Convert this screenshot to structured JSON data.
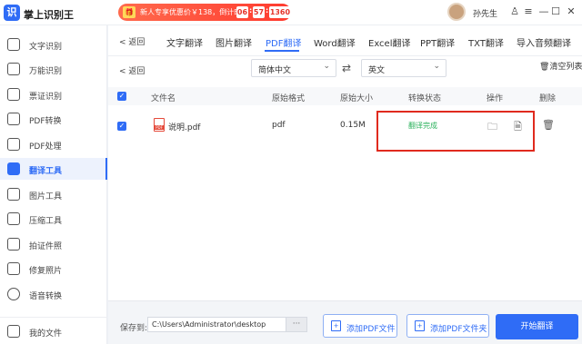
{
  "app": {
    "title": "掌上识别王",
    "logo_glyph": "识"
  },
  "promo": {
    "text": "新人专享优惠价￥138，倒计时",
    "countdown": [
      "06",
      "57",
      "13",
      "60"
    ],
    "separator": ":"
  },
  "user": {
    "name": "孙先生"
  },
  "window": {
    "skin": "♙",
    "menu": "≡",
    "minimize": "—",
    "maximize": "☐",
    "close": "✕"
  },
  "sidebar": {
    "items": [
      {
        "label": "文字识别",
        "icon": "text-recognition-icon"
      },
      {
        "label": "万能识别",
        "icon": "universal-recognition-icon"
      },
      {
        "label": "票证识别",
        "icon": "ticket-recognition-icon"
      },
      {
        "label": "PDF转换",
        "icon": "pdf-convert-icon"
      },
      {
        "label": "PDF处理",
        "icon": "pdf-process-icon"
      },
      {
        "label": "翻译工具",
        "icon": "translate-tool-icon",
        "active": true
      },
      {
        "label": "图片工具",
        "icon": "image-tool-icon"
      },
      {
        "label": "压缩工具",
        "icon": "compress-tool-icon"
      },
      {
        "label": "拍证件照",
        "icon": "id-photo-icon"
      },
      {
        "label": "修复照片",
        "icon": "photo-repair-icon"
      },
      {
        "label": "语音转换",
        "icon": "voice-convert-icon"
      }
    ],
    "my_files": "我的文件"
  },
  "nav": {
    "back": "返回",
    "tabs": [
      "文字翻译",
      "图片翻译",
      "PDF翻译",
      "Word翻译",
      "Excel翻译",
      "PPT翻译",
      "TXT翻译",
      "导入音频翻译"
    ],
    "active_tab": "PDF翻译"
  },
  "lang": {
    "back": "返回",
    "source": "简体中文",
    "target": "英文",
    "swap": "⇄",
    "clear_list": "清空列表"
  },
  "table": {
    "headers": [
      "文件名",
      "原始格式",
      "原始大小",
      "转换状态",
      "操作",
      "删除"
    ],
    "rows": [
      {
        "name": "说明.pdf",
        "format": "pdf",
        "size": "0.15M",
        "status": "翻译完成"
      }
    ]
  },
  "bottom": {
    "save_label": "保存到:",
    "path": "C:\\Users\\Administrator\\desktop",
    "browse": "···",
    "add_file": "添加PDF文件",
    "add_folder": "添加PDF文件夹",
    "start": "开始翻译"
  },
  "colors": {
    "accent": "#2f6cf6",
    "status_done": "#2cb25d",
    "highlight": "#e02a1e"
  }
}
